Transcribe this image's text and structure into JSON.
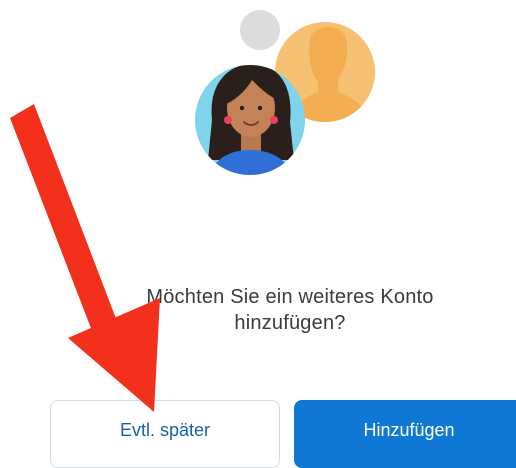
{
  "prompt": {
    "line1": "Möchten Sie ein weiteres Konto",
    "line2": "hinzufügen?"
  },
  "buttons": {
    "later_label": "Evtl. später",
    "add_label": "Hinzufügen"
  },
  "colors": {
    "primary_button": "#0f78d4",
    "secondary_button_text": "#1a5fb0",
    "annotation_arrow": "#f2301b",
    "avatar_background": "#7fd3ea",
    "placeholder_avatar": "#f7c173"
  },
  "icons": {
    "illustration": "add-account-avatars-illustration",
    "annotation": "red-arrow-annotation"
  }
}
